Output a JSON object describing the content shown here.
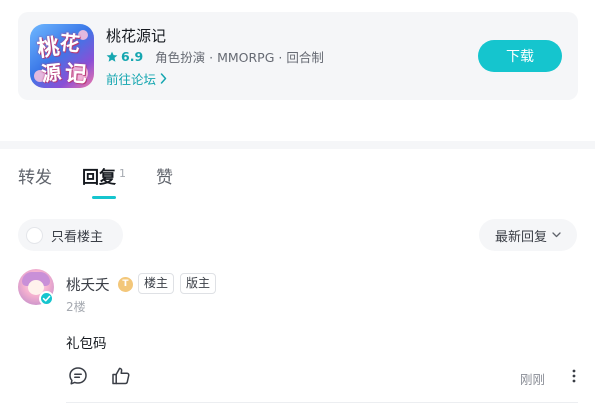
{
  "game": {
    "name": "桃花源记",
    "rating": "6.9",
    "tags": "角色扮演 · MMORPG · 回合制",
    "forum_link": "前往论坛",
    "download_label": "下载",
    "icon_glyphs": [
      "桃",
      "花",
      "源",
      "记"
    ]
  },
  "tabs": [
    {
      "label": "转发",
      "count": ""
    },
    {
      "label": "回复",
      "count": "1"
    },
    {
      "label": "赞",
      "count": ""
    }
  ],
  "filter": {
    "only_owner_label": "只看楼主",
    "sort_label": "最新回复"
  },
  "comment": {
    "username": "桃夭夭",
    "level": "T",
    "badges": [
      "楼主",
      "版主"
    ],
    "floor": "2楼",
    "content": "礼包码",
    "time": "刚刚"
  },
  "colors": {
    "accent": "#15c5ce",
    "accent_text": "#15a6b0",
    "card_bg": "#f5f6f8"
  },
  "icons": {
    "rating": "star-icon",
    "forum": "chevron-right-icon",
    "sort": "chevron-down-icon",
    "reply": "comment-icon",
    "like": "thumbs-up-icon",
    "more": "more-vertical-icon",
    "verified": "check-icon"
  }
}
